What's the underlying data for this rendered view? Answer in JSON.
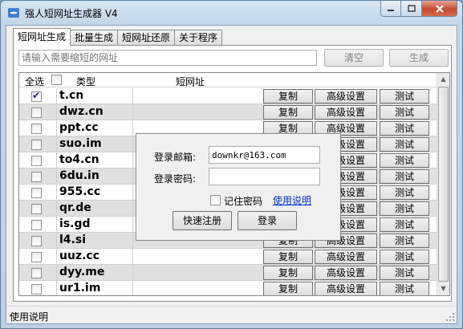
{
  "window": {
    "title": "强人短网址生成器 V4"
  },
  "tabs": [
    {
      "label": "短网址生成",
      "active": true
    },
    {
      "label": "批量生成",
      "active": false
    },
    {
      "label": "短网址还原",
      "active": false
    },
    {
      "label": "关于程序",
      "active": false
    }
  ],
  "toolbar": {
    "url_placeholder": "请输入需要缩短的网址",
    "clear_label": "清空",
    "generate_label": "生成"
  },
  "grid": {
    "header": {
      "select_all": "全选",
      "type": "类型",
      "short_url": "短网址"
    },
    "button_labels": {
      "copy": "复制",
      "advanced": "高级设置",
      "test": "测试"
    },
    "rows": [
      {
        "type": "t.cn",
        "checked": true
      },
      {
        "type": "dwz.cn",
        "checked": false
      },
      {
        "type": "ppt.cc",
        "checked": false
      },
      {
        "type": "suo.im",
        "checked": false
      },
      {
        "type": "to4.cn",
        "checked": false
      },
      {
        "type": "6du.in",
        "checked": false
      },
      {
        "type": "955.cc",
        "checked": false
      },
      {
        "type": "qr.de",
        "checked": false
      },
      {
        "type": "is.gd",
        "checked": false
      },
      {
        "type": "l4.si",
        "checked": false
      },
      {
        "type": "uuz.cc",
        "checked": false
      },
      {
        "type": "dyy.me",
        "checked": false
      },
      {
        "type": "ur1.im",
        "checked": false
      }
    ]
  },
  "login": {
    "email_label": "登录邮箱:",
    "email_value": "downkr@163.com",
    "password_label": "登录密码:",
    "password_value": "",
    "remember_label": "记住密码",
    "help_link": "使用说明",
    "register_label": "快速注册",
    "login_label": "登录"
  },
  "status": {
    "text": "使用说明"
  },
  "colors": {
    "title_bar": "#c3d6ea",
    "close_button": "#c84a32",
    "link": "#0033cc",
    "alt_row": "#e0e0e0"
  }
}
